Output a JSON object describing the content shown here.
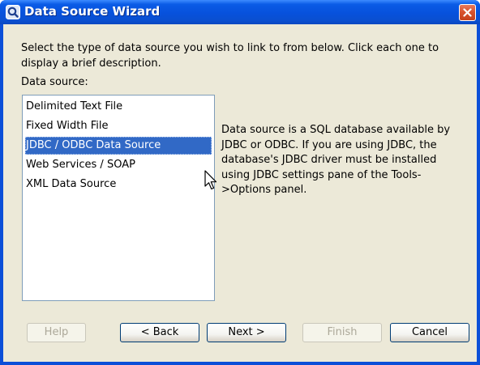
{
  "window": {
    "title": "Data Source Wizard",
    "close_icon": "close-icon",
    "app_icon": "wizard-app-icon"
  },
  "instructions": "Select the type of data source you wish to link to from below.  Click each one to display a brief description.",
  "data_source": {
    "label": "Data source:",
    "items": [
      {
        "label": "Delimited Text File",
        "selected": false
      },
      {
        "label": "Fixed Width File",
        "selected": false
      },
      {
        "label": "JDBC / ODBC Data Source",
        "selected": true
      },
      {
        "label": "Web Services / SOAP",
        "selected": false
      },
      {
        "label": "XML Data Source",
        "selected": false
      }
    ]
  },
  "description": "Data source is a SQL database available by JDBC or ODBC.  If you are using JDBC, the database's JDBC driver must be installed using JDBC settings pane of the Tools->Options panel.",
  "buttons": {
    "help": {
      "label": "Help",
      "enabled": false
    },
    "back": {
      "label": "< Back",
      "enabled": true
    },
    "next": {
      "label": "Next >",
      "enabled": true
    },
    "finish": {
      "label": "Finish",
      "enabled": false
    },
    "cancel": {
      "label": "Cancel",
      "enabled": true
    }
  },
  "colors": {
    "titlebar": "#0751dc",
    "dialog_bg": "#ece9d8",
    "selection": "#3169c6",
    "close_button": "#d9532e"
  }
}
